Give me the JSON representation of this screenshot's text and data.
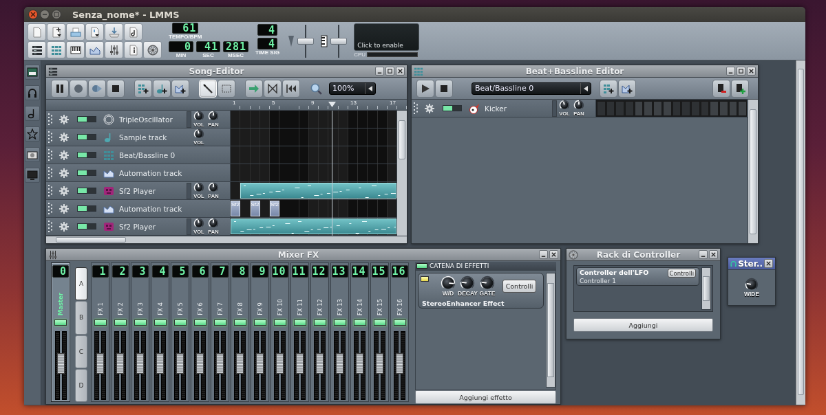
{
  "window": {
    "title": "Senza_nome* - LMMS"
  },
  "toolbar": {
    "tempo": {
      "value": "61",
      "label": "TEMPO/BPM"
    },
    "time": [
      {
        "value": "0",
        "label": "MIN"
      },
      {
        "value": "41",
        "label": "SEC"
      },
      {
        "value": "281",
        "label": "MSEC"
      }
    ],
    "time_signature": {
      "numerator": "4",
      "denominator": "4",
      "label": "TIME SIG"
    },
    "master_volume": {
      "level": 0.5
    },
    "master_pitch": {
      "level": 0.5
    },
    "cpu": {
      "hint": "Click to enable",
      "label": "CPU"
    }
  },
  "song_editor": {
    "title": "Song-Editor",
    "tools": [
      {
        "kind": "draw",
        "selected": true
      },
      {
        "kind": "select",
        "selected": false
      }
    ],
    "zoom": "100%",
    "timeline": [
      "1",
      "5",
      "9",
      "13",
      "17"
    ],
    "tracks": [
      {
        "name": "TripleOscillator",
        "kind": "triple-oscillator",
        "muted": false,
        "knobs": [
          {
            "label": "VOL",
            "level": 0.45
          },
          {
            "label": "PAN",
            "level": 0.5
          }
        ]
      },
      {
        "name": "Sample track",
        "kind": "sample",
        "muted": false,
        "knobs": [
          {
            "label": "VOL",
            "level": 0.45
          }
        ]
      },
      {
        "name": "Beat/Bassline 0",
        "kind": "beat-bassline",
        "muted": false
      },
      {
        "name": "Automation track",
        "kind": "automation",
        "muted": false
      },
      {
        "name": "Sf2 Player",
        "kind": "sf2-player",
        "muted": false,
        "knobs": [
          {
            "label": "VOL",
            "level": 0.45
          },
          {
            "label": "PAN",
            "level": 0.5
          }
        ],
        "clips": [
          {
            "kind": "rest"
          },
          {
            "kind": "melody"
          }
        ]
      },
      {
        "name": "Automation track",
        "kind": "automation",
        "muted": false,
        "clips": [
          {
            "kind": "automation",
            "label": "Sf2"
          },
          {
            "kind": "rest"
          },
          {
            "kind": "automation",
            "label": "Sf2"
          },
          {
            "kind": "rest"
          },
          {
            "kind": "automation",
            "label": "Sf2"
          }
        ]
      },
      {
        "name": "Sf2 Player",
        "kind": "sf2-player",
        "muted": false,
        "knobs": [
          {
            "label": "VOL",
            "level": 0.45
          },
          {
            "label": "PAN",
            "level": 0.5
          }
        ],
        "clips": [
          {
            "kind": "melody"
          }
        ]
      }
    ]
  },
  "bb_editor": {
    "title": "Beat+Bassline Editor",
    "selector": "Beat/Bassline 0",
    "tracks": [
      {
        "name": "Kicker",
        "kind": "kicker",
        "muted": false,
        "knobs": [
          {
            "label": "VOL",
            "level": 0.45
          },
          {
            "label": "PAN",
            "level": 0.5
          }
        ],
        "steps": [
          {
            "on": false
          },
          {
            "on": false
          },
          {
            "on": false
          },
          {
            "on": false
          },
          {
            "on": false
          },
          {
            "on": false
          },
          {
            "on": false
          },
          {
            "on": false
          },
          {
            "on": false
          },
          {
            "on": false
          },
          {
            "on": false
          },
          {
            "on": false
          },
          {
            "on": false
          },
          {
            "on": false
          },
          {
            "on": false
          },
          {
            "on": false
          }
        ]
      }
    ]
  },
  "mixer": {
    "title": "Mixer FX",
    "banks": [
      {
        "label": "A",
        "selected": true
      },
      {
        "label": "B",
        "selected": false
      },
      {
        "label": "C",
        "selected": false
      },
      {
        "label": "D",
        "selected": false
      }
    ],
    "channels": [
      {
        "number": "0",
        "name": "Master",
        "selected": true,
        "muted": false,
        "level": 0.55
      },
      {
        "number": "1",
        "name": "FX 1",
        "selected": false,
        "muted": false,
        "level": 0.55
      },
      {
        "number": "2",
        "name": "FX 2",
        "selected": false,
        "muted": false,
        "level": 0.55
      },
      {
        "number": "3",
        "name": "FX 3",
        "selected": false,
        "muted": false,
        "level": 0.55
      },
      {
        "number": "4",
        "name": "FX 4",
        "selected": false,
        "muted": false,
        "level": 0.55
      },
      {
        "number": "5",
        "name": "FX 5",
        "selected": false,
        "muted": false,
        "level": 0.55
      },
      {
        "number": "6",
        "name": "FX 6",
        "selected": false,
        "muted": false,
        "level": 0.55
      },
      {
        "number": "7",
        "name": "FX 7",
        "selected": false,
        "muted": false,
        "level": 0.55
      },
      {
        "number": "8",
        "name": "FX 8",
        "selected": false,
        "muted": false,
        "level": 0.55
      },
      {
        "number": "9",
        "name": "FX 9",
        "selected": false,
        "muted": false,
        "level": 0.55
      },
      {
        "number": "10",
        "name": "FX 10",
        "selected": false,
        "muted": false,
        "level": 0.55
      },
      {
        "number": "11",
        "name": "FX 11",
        "selected": false,
        "muted": false,
        "level": 0.55
      },
      {
        "number": "12",
        "name": "FX 12",
        "selected": false,
        "muted": false,
        "level": 0.55
      },
      {
        "number": "13",
        "name": "FX 13",
        "selected": false,
        "muted": false,
        "level": 0.55
      },
      {
        "number": "14",
        "name": "FX 14",
        "selected": false,
        "muted": false,
        "level": 0.55
      },
      {
        "number": "15",
        "name": "FX 15",
        "selected": false,
        "muted": false,
        "level": 0.55
      },
      {
        "number": "16",
        "name": "FX 16",
        "selected": false,
        "muted": false,
        "level": 0.55
      }
    ],
    "effects_chain": {
      "title": "CATENA DI EFFETTI",
      "enabled": true,
      "effects": [
        {
          "name": "StereoEnhancer Effect",
          "enabled": true,
          "knobs": [
            {
              "label": "W/D",
              "level": 0.85
            },
            {
              "label": "DECAY",
              "level": 0.2
            },
            {
              "label": "GATE",
              "level": 0.2
            }
          ],
          "button": "Controlli"
        }
      ],
      "add_button": "Aggiungi effetto"
    }
  },
  "controller_rack": {
    "title": "Rack di Controller",
    "controllers": [
      {
        "title": "Controller dell'LFO",
        "name": "Controller 1",
        "button": "Controlli"
      }
    ],
    "add_button": "Aggiungi"
  },
  "plugin_window": {
    "title": "Ster..",
    "knobs": [
      {
        "label": "WIDE",
        "level": 0.2
      }
    ]
  }
}
